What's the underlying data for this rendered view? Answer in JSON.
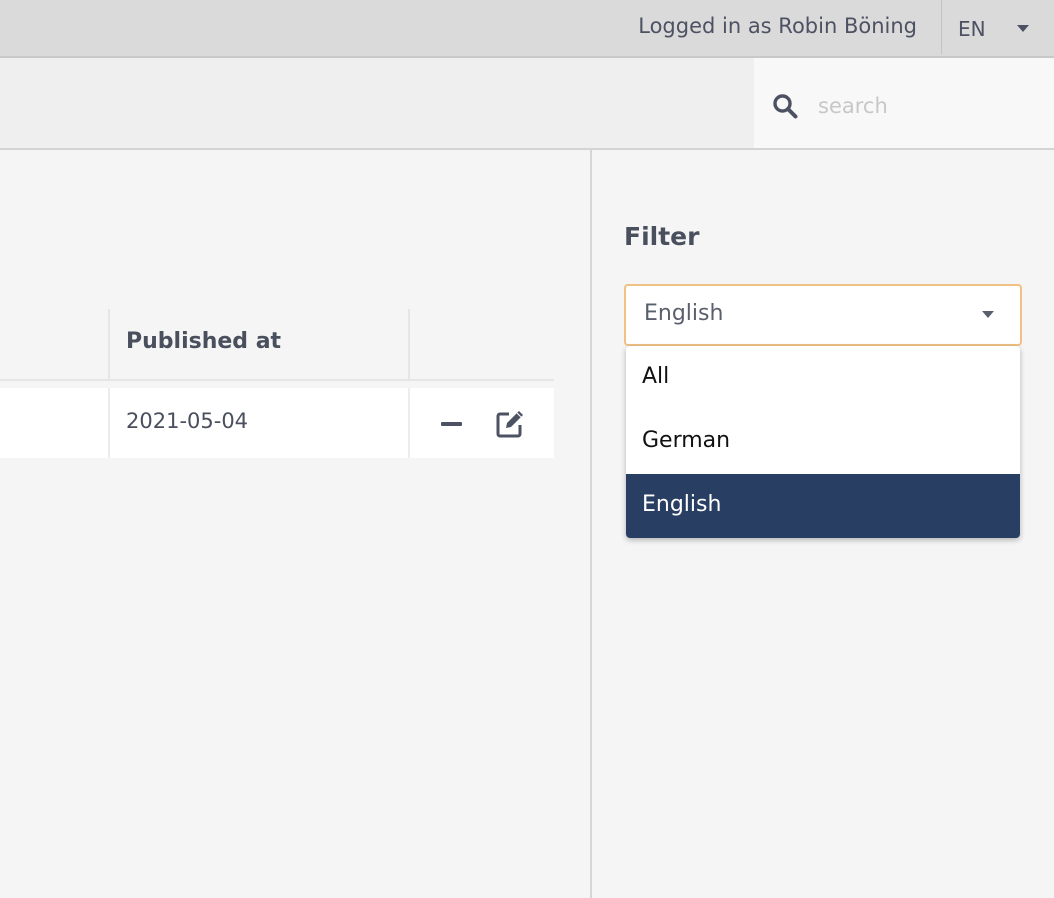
{
  "header": {
    "logged_in_text": "Logged in as Robin Böning",
    "language": "EN"
  },
  "search": {
    "placeholder": "search",
    "value": ""
  },
  "table": {
    "columns": [
      "Published at"
    ],
    "rows": [
      {
        "published_at": "2021-05-04"
      }
    ]
  },
  "filter": {
    "title": "Filter",
    "selected": "English",
    "options": [
      "All",
      "German",
      "English"
    ]
  },
  "colors": {
    "accent_border": "#f0c185",
    "selected_option": "#283f63"
  }
}
